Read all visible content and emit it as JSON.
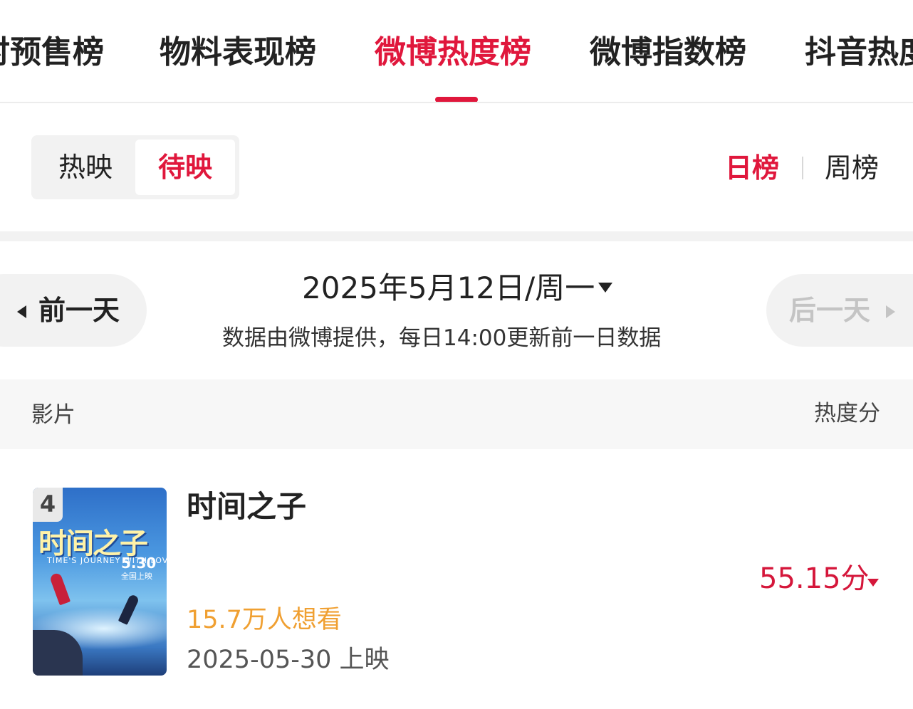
{
  "tabs": [
    "时预售榜",
    "物料表现榜",
    "微博热度榜",
    "微博指数榜",
    "抖音热度"
  ],
  "active_tab_index": 2,
  "segments": [
    "热映",
    "待映"
  ],
  "active_segment_index": 1,
  "rank_types": {
    "day": "日榜",
    "week": "周榜"
  },
  "active_rank_type": "day",
  "date_nav": {
    "prev_label": "前一天",
    "next_label": "后一天",
    "next_disabled": true,
    "date": "2025年5月12日/周一",
    "note": "数据由微博提供，每日14:00更新前一日数据"
  },
  "table": {
    "col_film": "影片",
    "col_score": "热度分",
    "rows": [
      {
        "rank": "4",
        "title": "时间之子",
        "want": "15.7万人想看",
        "release": "2025-05-30 上映",
        "score": "55.15分",
        "trend": "down",
        "poster": {
          "title": "时间之子",
          "subtitle": "TIME'S JOURNEY WITH LOVE",
          "date": "5.30",
          "release_text": "全国上映"
        }
      }
    ]
  },
  "colors": {
    "accent": "#e0173c",
    "score": "#d5173b",
    "want": "#f0a032",
    "disabled": "#c4c4c4",
    "muted_bg": "#f2f2f2"
  }
}
